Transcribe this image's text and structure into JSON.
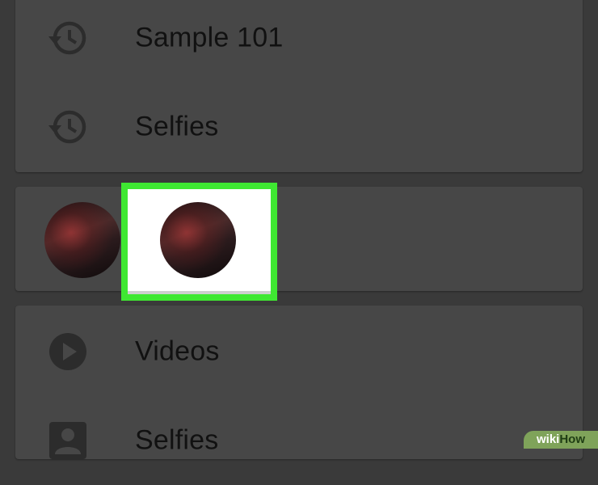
{
  "albums_card": {
    "items": [
      {
        "label": "Sample 101",
        "icon": "history-icon"
      },
      {
        "label": "Selfies",
        "icon": "history-icon"
      }
    ]
  },
  "people_card": {
    "faces": [
      "face-thumbnail",
      "face-thumbnail-highlighted"
    ]
  },
  "categories_card": {
    "items": [
      {
        "label": "Videos",
        "icon": "play-circle-icon"
      },
      {
        "label": "Selfies",
        "icon": "person-portrait-icon"
      }
    ]
  },
  "watermark": {
    "wiki": "wiki",
    "how": "How"
  },
  "colors": {
    "background": "#3a3a3a",
    "card": "#474747",
    "highlight_border": "#3fe832",
    "icon": "#2c2c2c",
    "text": "#111111"
  }
}
